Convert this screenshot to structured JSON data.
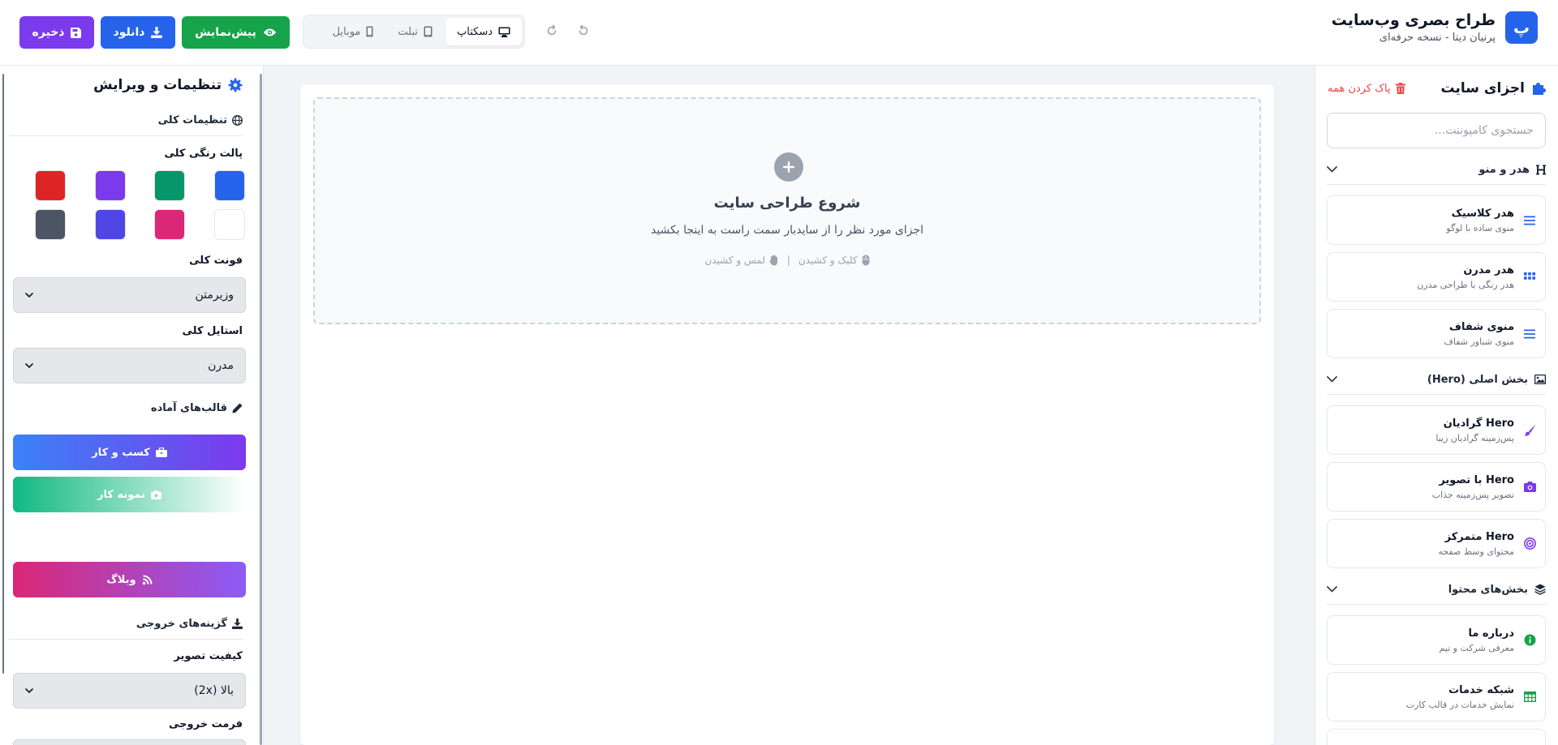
{
  "header": {
    "logo_letter": "پ",
    "title": "طراح بصری وب‌سایت",
    "subtitle": "پرنیان دیتا - نسخه حرفه‌ای",
    "devices": [
      {
        "label": "دسکتاپ",
        "icon": "desktop-icon",
        "active": true
      },
      {
        "label": "تبلت",
        "icon": "tablet-icon",
        "active": false
      },
      {
        "label": "موبایل",
        "icon": "mobile-icon",
        "active": false
      }
    ],
    "actions": {
      "preview": {
        "label": "پیش‌نمایش",
        "icon": "eye-icon",
        "color": "#16a34a"
      },
      "download": {
        "label": "دانلود",
        "icon": "download-icon",
        "color": "#2563eb"
      },
      "save": {
        "label": "ذخیره",
        "icon": "floppy-icon",
        "color": "#7c3aed"
      }
    }
  },
  "components_panel": {
    "title": "اجزای سایت",
    "clear_label": "پاک کردن همه",
    "search_placeholder": "جستجوی کامپوننت...",
    "categories": [
      {
        "label": "هدر و منو",
        "icon": "heading-icon",
        "items": [
          {
            "title": "هدر کلاسیک",
            "desc": "منوی ساده با لوگو",
            "icon": "bars-icon",
            "icon_color": "#2563eb"
          },
          {
            "title": "هدر مدرن",
            "desc": "هدر رنگی با طراحی مدرن",
            "icon": "grid-icon",
            "icon_color": "#2563eb"
          },
          {
            "title": "منوی شفاف",
            "desc": "منوی شناور شفاف",
            "icon": "bars-icon",
            "icon_color": "#2563eb"
          }
        ]
      },
      {
        "label": "بخش اصلی (Hero)",
        "icon": "image-icon",
        "items": [
          {
            "title": "Hero گرادیان",
            "desc": "پس‌زمینه گرادیان زیبا",
            "icon": "brush-icon",
            "icon_color": "#7c3aed"
          },
          {
            "title": "Hero با تصویر",
            "desc": "تصویر پس‌زمینه جذاب",
            "icon": "camera-icon",
            "icon_color": "#7c3aed"
          },
          {
            "title": "Hero متمرکز",
            "desc": "محتوای وسط صفحه",
            "icon": "target-icon",
            "icon_color": "#7c3aed"
          }
        ]
      },
      {
        "label": "بخش‌های محتوا",
        "icon": "layers-icon",
        "items": [
          {
            "title": "درباره ما",
            "desc": "معرفی شرکت و تیم",
            "icon": "info-icon",
            "icon_color": "#16a34a"
          },
          {
            "title": "شبکه خدمات",
            "desc": "نمایش خدمات در قالب کارت",
            "icon": "table-icon",
            "icon_color": "#16a34a"
          }
        ]
      }
    ]
  },
  "canvas": {
    "title": "شروع طراحی سایت",
    "desc": "اجزای مورد نظر را از سایدبار سمت راست به اینجا بکشید",
    "hint_mouse": "کلیک و کشیدن",
    "hint_touch": "لمس و کشیدن",
    "separator": "|"
  },
  "settings_panel": {
    "title": "تنظیمات و ویرایش",
    "general_section": "تنظیمات کلی",
    "palette_label": "پالت رنگی کلی",
    "palette": [
      "#2563eb",
      "#059669",
      "#7c3aed",
      "#dc2626",
      "#ffffff",
      "#db2777",
      "#4f46e5",
      "#4b5563"
    ],
    "font_label": "فونت کلی",
    "font_value": "وزیرمتن",
    "style_label": "استایل کلی",
    "style_value": "مدرن",
    "templates_section": "قالب‌های آماده",
    "templates": [
      {
        "label": "کسب و کار",
        "icon": "briefcase-icon"
      },
      {
        "label": "نمونه کار",
        "icon": "camera-icon"
      },
      {
        "label": "وبلاگ",
        "icon": "blog-icon"
      }
    ],
    "export_section": "گزینه‌های خروجی",
    "quality_label": "کیفیت تصویر",
    "quality_value": "بالا (2x)",
    "format_label": "فرمت خروجی"
  }
}
